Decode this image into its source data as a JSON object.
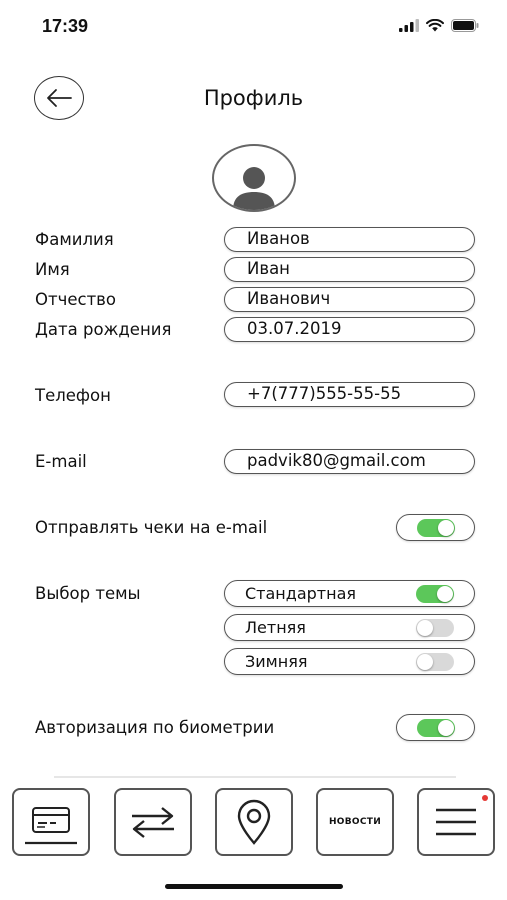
{
  "status_bar": {
    "time": "17:39"
  },
  "header": {
    "title": "Профиль"
  },
  "fields": [
    {
      "label": "Фамилия",
      "value": "Иванов"
    },
    {
      "label": "Имя",
      "value": "Иван"
    },
    {
      "label": "Отчество",
      "value": "Иванович"
    },
    {
      "label": "Дата рождения",
      "value": "03.07.2019"
    },
    {
      "label": "Телефон",
      "value": "+7(777)555-55-55"
    },
    {
      "label": "E-mail",
      "value": "padvik80@gmail.com"
    }
  ],
  "receipts": {
    "label": "Отправлять чеки на e-mail",
    "enabled": true
  },
  "theme": {
    "label": "Выбор темы",
    "options": [
      {
        "label": "Стандартная",
        "selected": true
      },
      {
        "label": "Летняя",
        "selected": false
      },
      {
        "label": "Зимняя",
        "selected": false
      }
    ]
  },
  "biometrics": {
    "label": "Авторизация по биометрии",
    "enabled": true
  },
  "bottom_nav": {
    "items": [
      {
        "icon": "card-icon"
      },
      {
        "icon": "transfer-arrows-icon"
      },
      {
        "icon": "map-pin-icon"
      },
      {
        "label": "НОВОСТИ"
      },
      {
        "icon": "hamburger-menu-icon",
        "badge": true
      }
    ]
  },
  "colors": {
    "toggle_on": "#5cc75a",
    "toggle_off": "#d9d9d9",
    "badge": "#e53935"
  }
}
